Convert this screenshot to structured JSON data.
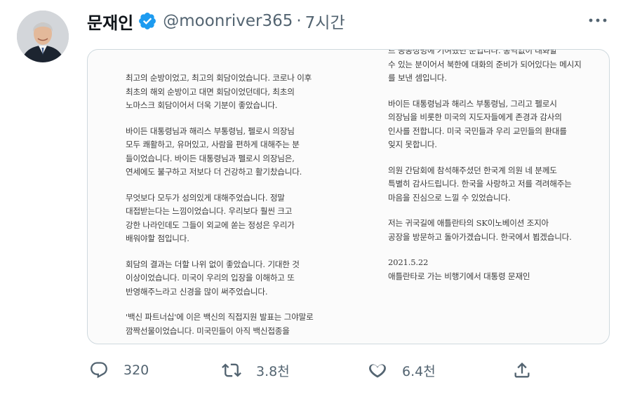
{
  "tweet": {
    "display_name": "문재인",
    "handle": "@moonriver365",
    "separator": "·",
    "time": "7시간"
  },
  "icons": {
    "verified": "verified-badge-icon",
    "more": "more-dots-icon",
    "reply": "reply-icon",
    "retweet": "retweet-icon",
    "like": "heart-icon",
    "share": "share-icon"
  },
  "colors": {
    "verified": "#1d9bf0",
    "text_secondary": "#536471",
    "border": "#cfd9de"
  },
  "letter": {
    "left_paragraphs": [
      [
        "최고의 순방이었고, 최고의 회담이었습니다. 코로나 이후",
        "최초의 해외 순방이고 대면 회담이었던데다, 최초의",
        "노마스크 회담이어서 더욱 기분이 좋았습니다."
      ],
      [
        "바이든 대통령님과 해리스 부통령님, 펠로시 의장님",
        "모두 쾌활하고, 유머있고, 사람을 편하게 대해주는 분",
        "들이었습니다. 바이든 대통령님과 펠로시 의장님은,",
        "연세에도 불구하고 저보다 더 건강하고 활기찼습니다."
      ],
      [
        "무엇보다 모두가 성의있게 대해주었습니다. 정말",
        "대접받는다는 느낌이었습니다. 우리보다 훨씬 크고",
        "강한 나라인데도 그들이 외교에 쏟는 정성은 우리가",
        "배워야할 점입니다."
      ],
      [
        "회담의 결과는 더할 나위 없이 좋았습니다. 기대한 것",
        "이상이었습니다. 미국이 우리의 입장을 이해하고 또",
        "반영해주느라고 신경을 많이 써주었습니다."
      ],
      [
        "'백신 파트너십'에 이은 백신의 직접지원 발표는 그야말로",
        "깜짝선물이었습니다. 미국민들이 아직 백신접종을"
      ]
    ],
    "right_paragraphs": [
      [
        "르 공동성명에 기여했던 분입니다. 통역없이 대화할",
        "수 있는 분이어서 북한에 대화의 준비가 되어있다는 메시지",
        "를 보낸 셈입니다."
      ],
      [
        "바이든 대통령님과 해리스 부통령님, 그리고 펠로시",
        "의장님을 비롯한 미국의 지도자들에게 존경과 감사의",
        "인사를 전합니다. 미국 국민들과 우리 교민들의 환대를",
        "잊지 못합니다."
      ],
      [
        "의원 간담회에 참석해주셨던 한국계 의원 네 분께도",
        "특별히 감사드립니다. 한국을 사랑하고 저를 격려해주는",
        "마음을 진심으로 느낄 수 있었습니다."
      ],
      [
        "저는 귀국길에 애틀란타의 SK이노베이션 조지아",
        "공장을 방문하고 돌아가겠습니다. 한국에서 뵙겠습니다."
      ],
      [
        "2021.5.22",
        "애틀란타로 가는 비행기에서 대통령 문재인"
      ]
    ]
  },
  "stats": {
    "replies": "320",
    "retweets": "3.8천",
    "likes": "6.4천"
  }
}
